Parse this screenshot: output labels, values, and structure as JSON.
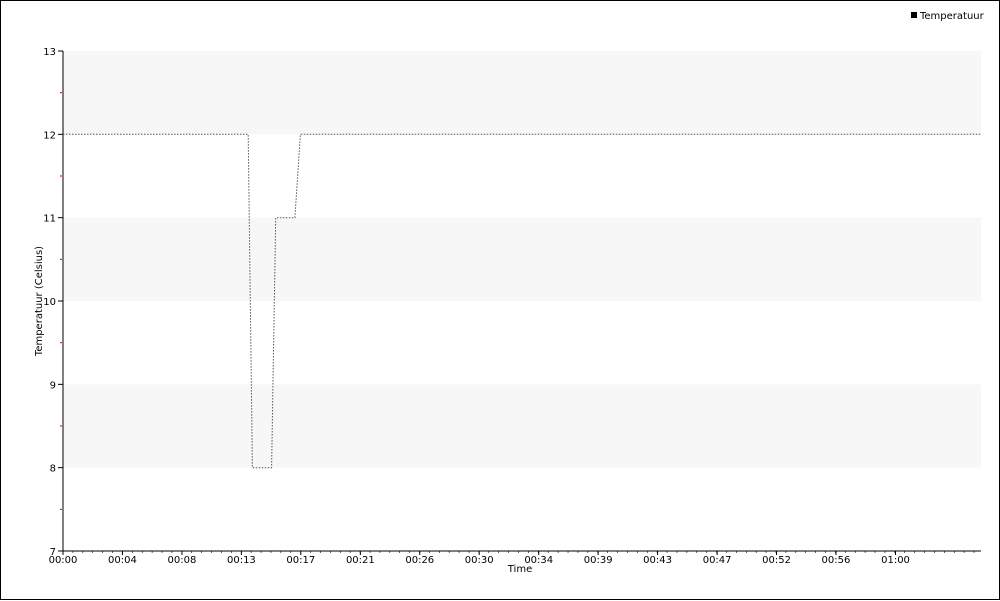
{
  "chart_data": {
    "type": "line",
    "title": "",
    "xlabel": "Time",
    "ylabel": "Temperatuur (Celsius)",
    "xlim_minutes": [
      0,
      66.9
    ],
    "ylim": [
      7,
      13
    ],
    "yticks": [
      7,
      8,
      9,
      10,
      11,
      12,
      13
    ],
    "xtick_labels": [
      "00:00",
      "00:04",
      "00:08",
      "00:13",
      "00:17",
      "00:21",
      "00:26",
      "00:30",
      "00:34",
      "00:39",
      "00:43",
      "00:47",
      "00:52",
      "00:56",
      "01:00"
    ],
    "xtick_minutes": [
      0,
      4.33,
      8.67,
      13,
      17.33,
      21.67,
      26,
      30.33,
      34.67,
      39,
      43.33,
      47.67,
      52,
      56.33,
      60.67
    ],
    "legend": {
      "position": "top-right",
      "marker_color": "#000000"
    },
    "grid": {
      "horizontal_bands": true,
      "band_color": "#f7f7f7"
    },
    "series": [
      {
        "name": "Temperatuur",
        "color": "#555555",
        "points": [
          {
            "x": 0,
            "y": 12
          },
          {
            "x": 13.5,
            "y": 12
          },
          {
            "x": 13.8,
            "y": 8
          },
          {
            "x": 15.2,
            "y": 8
          },
          {
            "x": 15.5,
            "y": 11
          },
          {
            "x": 16.9,
            "y": 11
          },
          {
            "x": 17.3,
            "y": 12
          },
          {
            "x": 66.9,
            "y": 12
          }
        ]
      }
    ]
  }
}
